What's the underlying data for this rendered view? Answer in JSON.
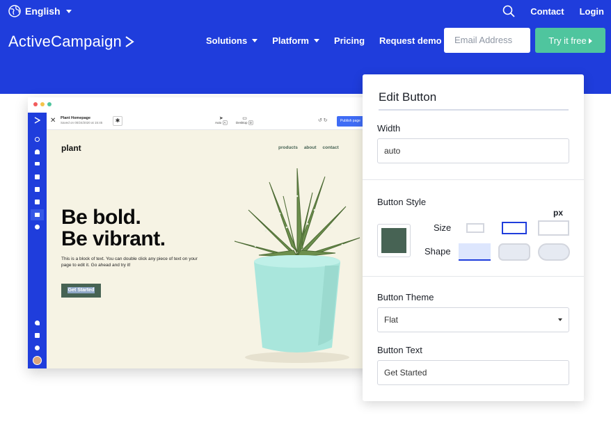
{
  "topbar": {
    "language": "English",
    "contact": "Contact",
    "login": "Login"
  },
  "nav": {
    "logo": "ActiveCampaign",
    "items": [
      {
        "label": "Solutions",
        "dropdown": true
      },
      {
        "label": "Platform",
        "dropdown": true
      },
      {
        "label": "Pricing",
        "dropdown": false
      },
      {
        "label": "Request demo",
        "dropdown": false
      }
    ],
    "email_placeholder": "Email Address",
    "cta": "Try it free"
  },
  "app": {
    "page_title": "Plant Homepage",
    "page_subtitle": "Saved on 00/24/2020 at 15:45",
    "auto_label": "Auto",
    "auto_value": "A",
    "desktop_label": "Desktop",
    "desktop_value": "D",
    "publish": "Publish page",
    "canvas": {
      "logo": "plant",
      "nav": [
        "products",
        "about",
        "contact"
      ],
      "headline_line1": "Be bold.",
      "headline_line2": "Be vibrant.",
      "paragraph": "This is a block of text. You can double click any piece of text on your page to edit it. Go ahead and try it!",
      "button": "Get Started"
    }
  },
  "panel": {
    "title": "Edit Button",
    "width_label": "Width",
    "width_value": "auto",
    "style_label": "Button Style",
    "size_label": "Size",
    "size_unit": "px",
    "shape_label": "Shape",
    "theme_label": "Button Theme",
    "theme_value": "Flat",
    "text_label": "Button Text",
    "text_value": "Get Started",
    "button_color": "#476354"
  },
  "colors": {
    "brand_blue": "#1f3ddc",
    "cta_green": "#4fc59e",
    "canvas_bg": "#f6f3e4",
    "selected_option": "#1f3ddc"
  }
}
